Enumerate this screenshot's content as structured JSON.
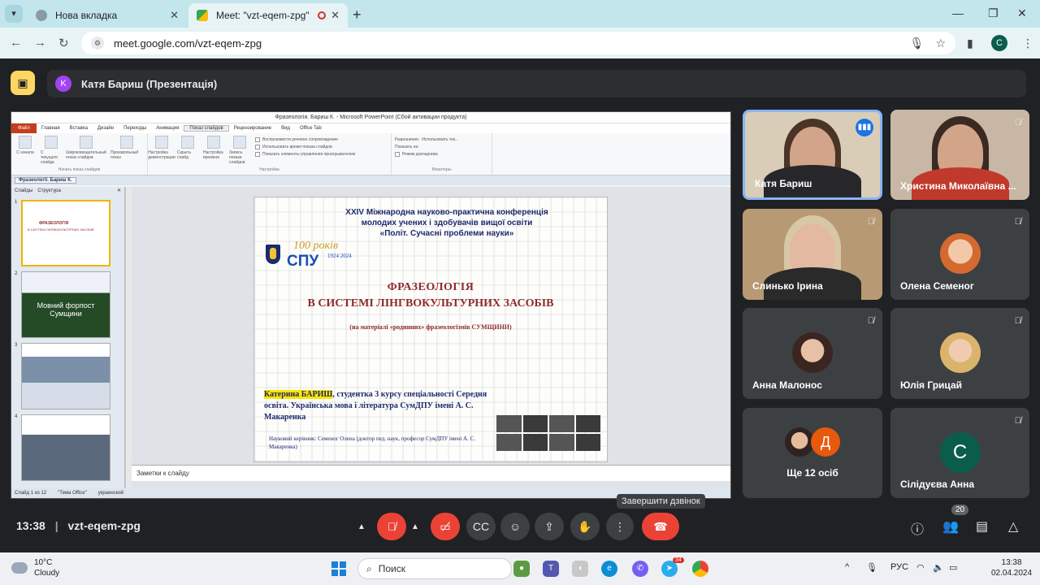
{
  "browser": {
    "tabs": [
      {
        "title": "Нова вкладка",
        "active": false
      },
      {
        "title": "Meet: \"vzt-eqem-zpg\"",
        "active": true
      }
    ],
    "url": "meet.google.com/vzt-eqem-zpg",
    "profile_letter": "C"
  },
  "meet": {
    "presenter_avatar": "K",
    "presenter_title": "Катя Бариш (Презентація)",
    "meeting_code": "vzt-eqem-zpg",
    "time": "13:38",
    "end_call_tooltip": "Завершити дзвінок",
    "participant_count": "20",
    "participants": [
      {
        "name": "Катя Бариш",
        "type": "video",
        "speaking": true
      },
      {
        "name": "Христина Миколаївна ...",
        "type": "video",
        "muted": true
      },
      {
        "name": "Слинько Ірина",
        "type": "video",
        "muted": true
      },
      {
        "name": "Олена Семеног",
        "type": "photo",
        "muted": true
      },
      {
        "name": "Анна Малонос",
        "type": "photo",
        "muted": true
      },
      {
        "name": "Юлія Грицай",
        "type": "photo",
        "muted": true
      },
      {
        "name": "Ще 12 осіб",
        "type": "more",
        "letter": "Д"
      },
      {
        "name": "Сілідуєва Анна",
        "type": "letter",
        "letter": "C",
        "muted": true
      }
    ]
  },
  "powerpoint": {
    "window_title": "Фразеологія. Бариш К. - Microsoft PowerPoint (Сбой активации продукта)",
    "menu": [
      "Файл",
      "Главная",
      "Вставка",
      "Дизайн",
      "Переходы",
      "Анимация",
      "Показ слайдов",
      "Рецензирование",
      "Вид",
      "Office Tab"
    ],
    "ribbon_group1": [
      "С начала",
      "С текущего слайда",
      "Широковещательный показ слайдов",
      "Произвольный показ"
    ],
    "ribbon_group1_name": "Начать показ слайдов",
    "ribbon_group2": [
      "Настройка демонстрации",
      "Скрыть слайд",
      "Настройка времени",
      "Запись показа слайдов"
    ],
    "ribbon_checks": [
      "Воспроизвести речевое сопровождение",
      "Использовать время показа слайдов",
      "Показать элементы управления проигрывателем"
    ],
    "ribbon_group2_name": "Настройка",
    "ribbon_monitor": [
      "Разрешение:",
      "Показать на:",
      "Режим докладчика"
    ],
    "ribbon_monitor_value": "Использовать тек...",
    "ribbon_group3_name": "Мониторы",
    "doc_tab": "Фразеології. Бариш К.",
    "panel_tabs": [
      "Слайды",
      "Структура"
    ],
    "thumb2_text": "Мовний форпост Сумщини",
    "notes_placeholder": "Заметки к слайду",
    "status": [
      "Слайд 1 из 12",
      "\"Тема Office\"",
      "украинский"
    ]
  },
  "slide": {
    "conference": [
      "XXIV Міжнародна науково-практична конференція",
      "молодих учених і здобувачів вищої освіти",
      "«Політ. Сучасні проблеми науки»"
    ],
    "logo_100": "100 років",
    "logo_spu": "СПУ",
    "logo_years": "1924 2024",
    "title_line1": "ФРАЗЕОЛОГІЯ",
    "title_line2": "В СИСТЕМІ ЛІНГВОКУЛЬТУРНИХ ЗАСОБІВ",
    "subtitle": "(на матеріалі «родинних» фразеологізмів СУМЩИНИ)",
    "author_highlight": "Катерина БАРИШ",
    "author_rest": ", студентка 3 курсу спеціальності Середня освіта. Українська мова і література СумДПУ імені А. С. Макаренка",
    "advisor": "Науковий керівник: Семеног Олена (доктор пед. наук, професор СумДПУ імені А. С. Макаренка)"
  },
  "taskbar": {
    "temp": "10°C",
    "weather": "Cloudy",
    "search": "Поиск",
    "lang": "РУС",
    "time": "13:38",
    "date": "02.04.2024",
    "telegram_badge": "34"
  }
}
